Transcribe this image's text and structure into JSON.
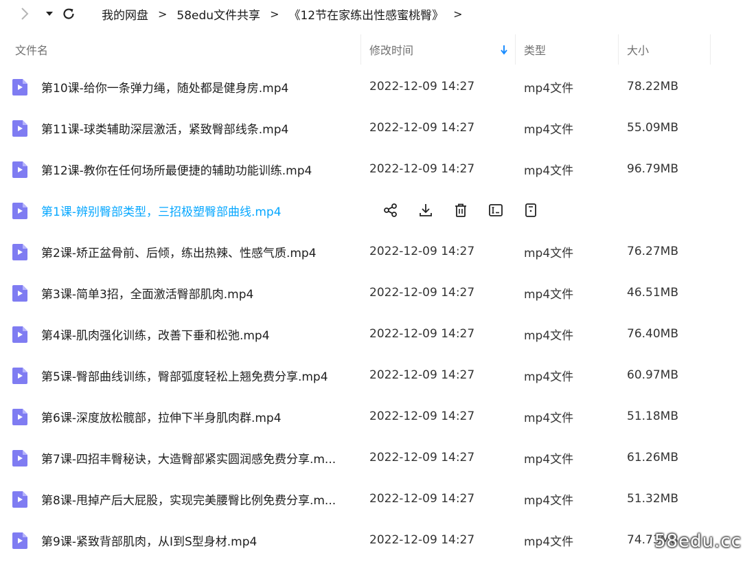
{
  "breadcrumb": [
    {
      "label": "我的网盘"
    },
    {
      "label": "58edu文件共享"
    },
    {
      "label": "《12节在家练出性感蜜桃臀》"
    }
  ],
  "columns": {
    "name": "文件名",
    "modified": "修改时间",
    "type": "类型",
    "size": "大小"
  },
  "files": [
    {
      "name": "第10课-给你一条弹力绳，随处都是健身房.mp4",
      "modified": "2022-12-09 14:27",
      "type": "mp4文件",
      "size": "78.22MB"
    },
    {
      "name": "第11课-球类辅助深层激活，紧致臀部线条.mp4",
      "modified": "2022-12-09 14:27",
      "type": "mp4文件",
      "size": "55.09MB"
    },
    {
      "name": "第12课-教你在任何场所最便捷的辅助功能训练.mp4",
      "modified": "2022-12-09 14:27",
      "type": "mp4文件",
      "size": "96.79MB"
    },
    {
      "name": "第1课-辨别臀部类型，三招极塑臀部曲线.mp4",
      "modified": "",
      "type": "",
      "size": "",
      "hover": true
    },
    {
      "name": "第2课-矫正盆骨前、后倾，练出热辣、性感气质.mp4",
      "modified": "2022-12-09 14:27",
      "type": "mp4文件",
      "size": "76.27MB"
    },
    {
      "name": "第3课-简单3招，全面激活臀部肌肉.mp4",
      "modified": "2022-12-09 14:27",
      "type": "mp4文件",
      "size": "46.51MB"
    },
    {
      "name": "第4课-肌肉强化训练，改善下垂和松弛.mp4",
      "modified": "2022-12-09 14:27",
      "type": "mp4文件",
      "size": "76.40MB"
    },
    {
      "name": "第5课-臀部曲线训练，臀部弧度轻松上翘免费分享.mp4",
      "modified": "2022-12-09 14:27",
      "type": "mp4文件",
      "size": "60.97MB"
    },
    {
      "name": "第6课-深度放松髋部，拉伸下半身肌肉群.mp4",
      "modified": "2022-12-09 14:27",
      "type": "mp4文件",
      "size": "51.18MB"
    },
    {
      "name": "第7课-四招丰臀秘诀，大造臀部紧实圆润感免费分享.m...",
      "modified": "2022-12-09 14:27",
      "type": "mp4文件",
      "size": "61.26MB"
    },
    {
      "name": "第8课-甩掉产后大屁股，实现完美腰臀比例免费分享.m...",
      "modified": "2022-12-09 14:27",
      "type": "mp4文件",
      "size": "51.32MB"
    },
    {
      "name": "第9课-紧致背部肌肉，从I到S型身材.mp4",
      "modified": "2022-12-09 14:27",
      "type": "mp4文件",
      "size": "74.73MB"
    }
  ],
  "row_actions": [
    "share-icon",
    "download-icon",
    "delete-icon",
    "rename-icon",
    "more-icon"
  ],
  "watermark": "58edu.cc",
  "colors": {
    "accent": "#06a7ff",
    "file_icon": "#7f7cf2"
  }
}
